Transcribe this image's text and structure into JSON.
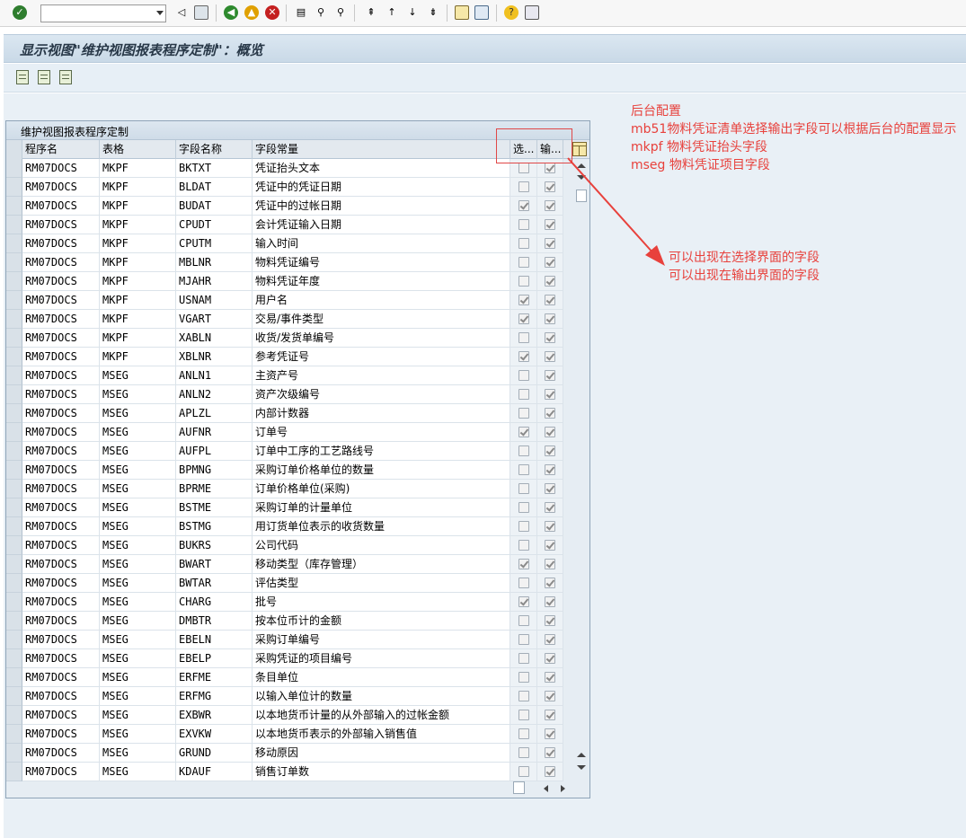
{
  "toolbar": {
    "command_field_value": ""
  },
  "title": "显示视图\"维护视图报表程序定制\"：概览",
  "table": {
    "title": "维护视图报表程序定制",
    "columns": [
      "程序名",
      "表格",
      "字段名称",
      "字段常量",
      "选...",
      "输..."
    ],
    "rows": [
      {
        "prog": "RM07DOCS",
        "table": "MKPF",
        "field": "BKTXT",
        "desc": "凭证抬头文本",
        "sel": false,
        "out": true
      },
      {
        "prog": "RM07DOCS",
        "table": "MKPF",
        "field": "BLDAT",
        "desc": "凭证中的凭证日期",
        "sel": false,
        "out": true
      },
      {
        "prog": "RM07DOCS",
        "table": "MKPF",
        "field": "BUDAT",
        "desc": "凭证中的过帐日期",
        "sel": true,
        "out": true
      },
      {
        "prog": "RM07DOCS",
        "table": "MKPF",
        "field": "CPUDT",
        "desc": "会计凭证输入日期",
        "sel": false,
        "out": true
      },
      {
        "prog": "RM07DOCS",
        "table": "MKPF",
        "field": "CPUTM",
        "desc": "输入时间",
        "sel": false,
        "out": true
      },
      {
        "prog": "RM07DOCS",
        "table": "MKPF",
        "field": "MBLNR",
        "desc": "物料凭证编号",
        "sel": false,
        "out": true
      },
      {
        "prog": "RM07DOCS",
        "table": "MKPF",
        "field": "MJAHR",
        "desc": "物料凭证年度",
        "sel": false,
        "out": true
      },
      {
        "prog": "RM07DOCS",
        "table": "MKPF",
        "field": "USNAM",
        "desc": "用户名",
        "sel": true,
        "out": true
      },
      {
        "prog": "RM07DOCS",
        "table": "MKPF",
        "field": "VGART",
        "desc": "交易/事件类型",
        "sel": true,
        "out": true
      },
      {
        "prog": "RM07DOCS",
        "table": "MKPF",
        "field": "XABLN",
        "desc": "收货/发货单编号",
        "sel": false,
        "out": true
      },
      {
        "prog": "RM07DOCS",
        "table": "MKPF",
        "field": "XBLNR",
        "desc": "参考凭证号",
        "sel": true,
        "out": true
      },
      {
        "prog": "RM07DOCS",
        "table": "MSEG",
        "field": "ANLN1",
        "desc": "主资产号",
        "sel": false,
        "out": true
      },
      {
        "prog": "RM07DOCS",
        "table": "MSEG",
        "field": "ANLN2",
        "desc": "资产次级编号",
        "sel": false,
        "out": true
      },
      {
        "prog": "RM07DOCS",
        "table": "MSEG",
        "field": "APLZL",
        "desc": "内部计数器",
        "sel": false,
        "out": true
      },
      {
        "prog": "RM07DOCS",
        "table": "MSEG",
        "field": "AUFNR",
        "desc": "订单号",
        "sel": true,
        "out": true
      },
      {
        "prog": "RM07DOCS",
        "table": "MSEG",
        "field": "AUFPL",
        "desc": "订单中工序的工艺路线号",
        "sel": false,
        "out": true
      },
      {
        "prog": "RM07DOCS",
        "table": "MSEG",
        "field": "BPMNG",
        "desc": "采购订单价格单位的数量",
        "sel": false,
        "out": true
      },
      {
        "prog": "RM07DOCS",
        "table": "MSEG",
        "field": "BPRME",
        "desc": "订单价格单位(采购)",
        "sel": false,
        "out": true
      },
      {
        "prog": "RM07DOCS",
        "table": "MSEG",
        "field": "BSTME",
        "desc": "采购订单的计量单位",
        "sel": false,
        "out": true
      },
      {
        "prog": "RM07DOCS",
        "table": "MSEG",
        "field": "BSTMG",
        "desc": "用订货单位表示的收货数量",
        "sel": false,
        "out": true
      },
      {
        "prog": "RM07DOCS",
        "table": "MSEG",
        "field": "BUKRS",
        "desc": "公司代码",
        "sel": false,
        "out": true
      },
      {
        "prog": "RM07DOCS",
        "table": "MSEG",
        "field": "BWART",
        "desc": "移动类型（库存管理）",
        "sel": true,
        "out": true
      },
      {
        "prog": "RM07DOCS",
        "table": "MSEG",
        "field": "BWTAR",
        "desc": "评估类型",
        "sel": false,
        "out": true
      },
      {
        "prog": "RM07DOCS",
        "table": "MSEG",
        "field": "CHARG",
        "desc": "批号",
        "sel": true,
        "out": true
      },
      {
        "prog": "RM07DOCS",
        "table": "MSEG",
        "field": "DMBTR",
        "desc": "按本位币计的金额",
        "sel": false,
        "out": true
      },
      {
        "prog": "RM07DOCS",
        "table": "MSEG",
        "field": "EBELN",
        "desc": "采购订单编号",
        "sel": false,
        "out": true
      },
      {
        "prog": "RM07DOCS",
        "table": "MSEG",
        "field": "EBELP",
        "desc": "采购凭证的项目编号",
        "sel": false,
        "out": true
      },
      {
        "prog": "RM07DOCS",
        "table": "MSEG",
        "field": "ERFME",
        "desc": "条目单位",
        "sel": false,
        "out": true
      },
      {
        "prog": "RM07DOCS",
        "table": "MSEG",
        "field": "ERFMG",
        "desc": "以输入单位计的数量",
        "sel": false,
        "out": true
      },
      {
        "prog": "RM07DOCS",
        "table": "MSEG",
        "field": "EXBWR",
        "desc": "以本地货币计量的从外部输入的过帐金额",
        "sel": false,
        "out": true
      },
      {
        "prog": "RM07DOCS",
        "table": "MSEG",
        "field": "EXVKW",
        "desc": "以本地货币表示的外部输入销售值",
        "sel": false,
        "out": true
      },
      {
        "prog": "RM07DOCS",
        "table": "MSEG",
        "field": "GRUND",
        "desc": "移动原因",
        "sel": false,
        "out": true
      },
      {
        "prog": "RM07DOCS",
        "table": "MSEG",
        "field": "KDAUF",
        "desc": "销售订单数",
        "sel": false,
        "out": true
      }
    ]
  },
  "annotation": {
    "note_lines": [
      "后台配置",
      "mb51物料凭证清单选择输出字段可以根据后台的配置显示",
      "mkpf 物料凭证抬头字段",
      "mseg 物料凭证项目字段"
    ],
    "arrow_lines": [
      "可以出现在选择界面的字段",
      "可以出现在输出界面的字段"
    ],
    "color": "#e8413c"
  }
}
